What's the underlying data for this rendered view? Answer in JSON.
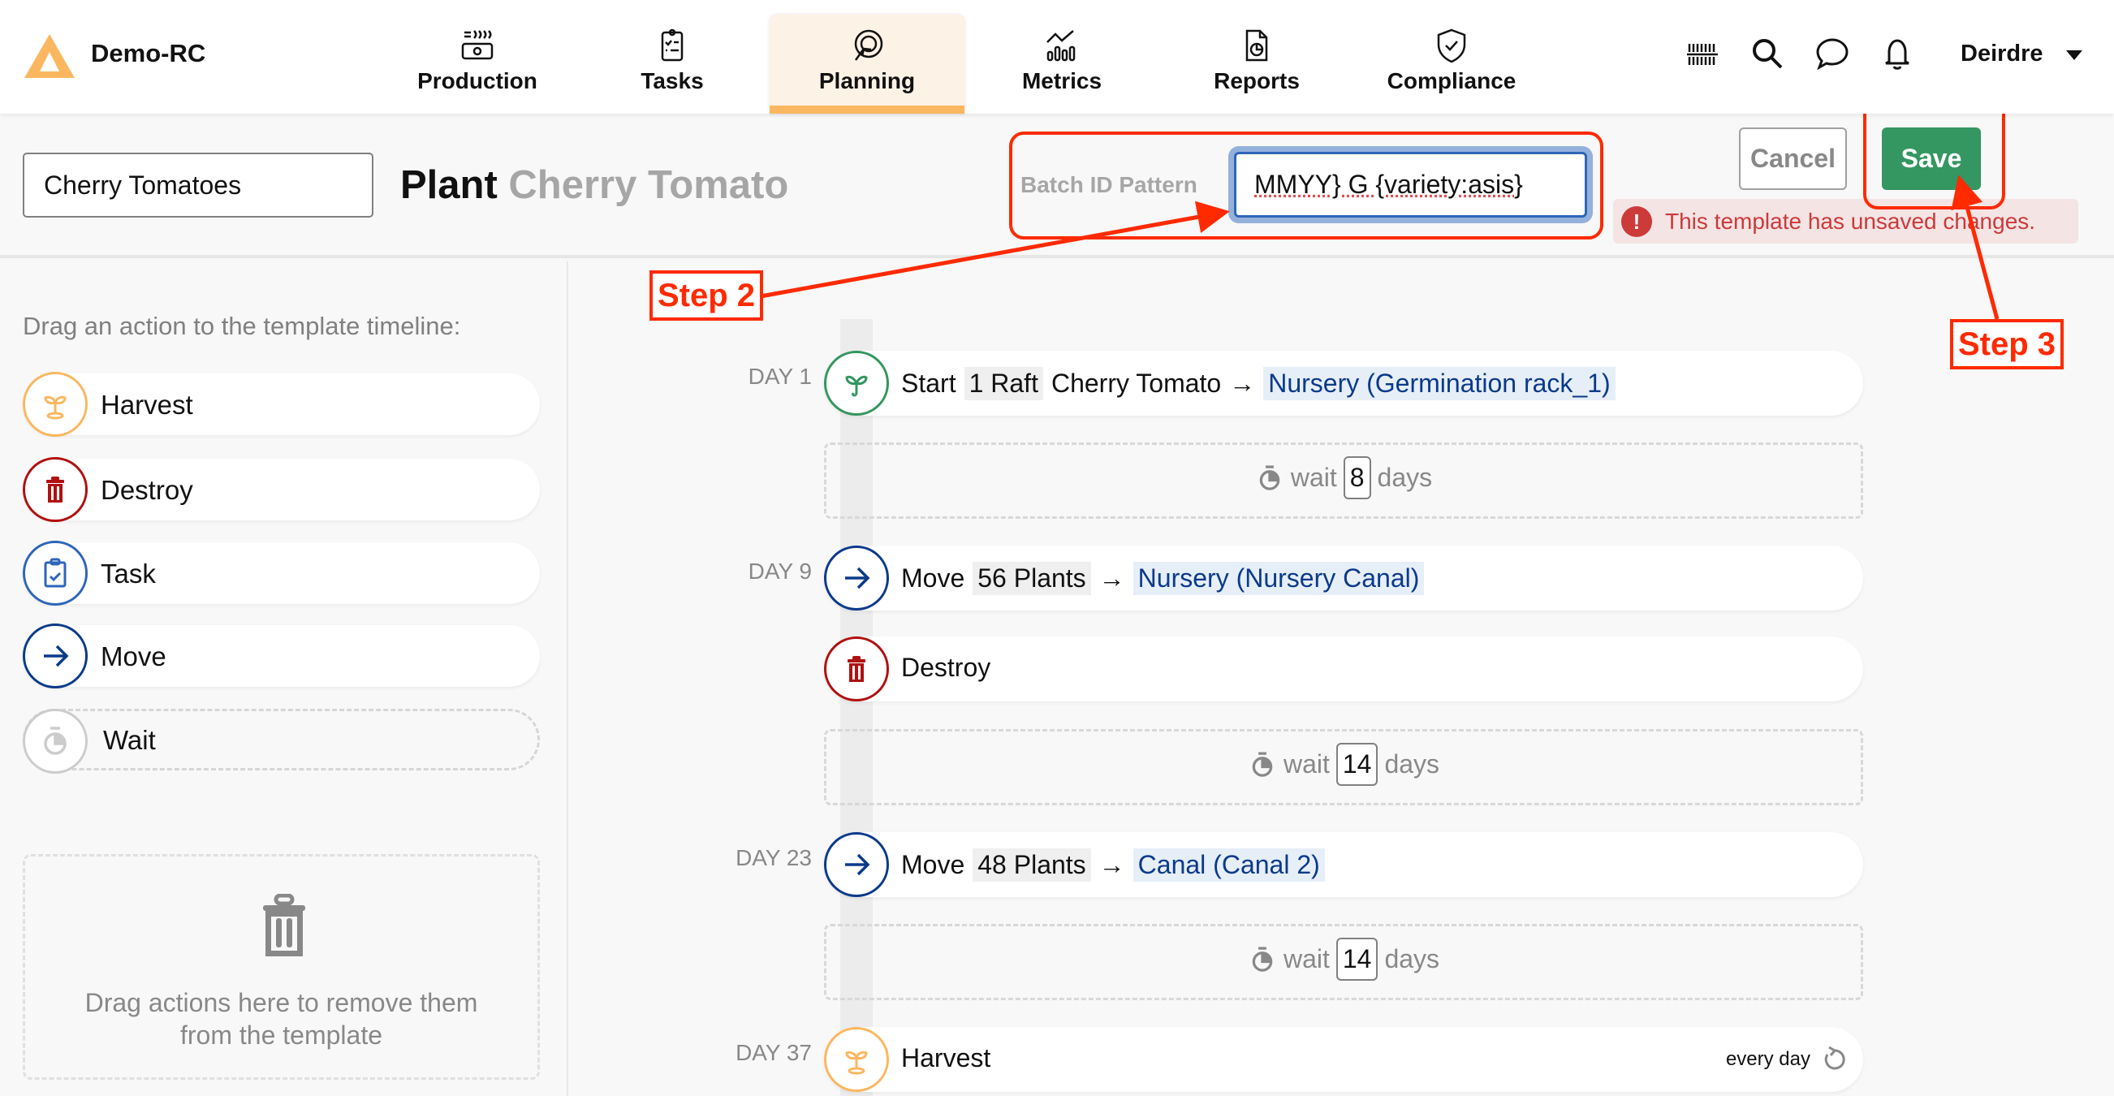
{
  "app": {
    "brand": "Demo-RC",
    "accent": "#fbb760"
  },
  "nav": [
    {
      "label": "Production",
      "icon": "production-icon"
    },
    {
      "label": "Tasks",
      "icon": "tasks-icon"
    },
    {
      "label": "Planning",
      "icon": "planning-icon",
      "active": true
    },
    {
      "label": "Metrics",
      "icon": "metrics-icon"
    },
    {
      "label": "Reports",
      "icon": "reports-icon"
    },
    {
      "label": "Compliance",
      "icon": "compliance-icon"
    }
  ],
  "header_right": {
    "user": "Deirdre",
    "icons": [
      "barcode-icon",
      "search-icon",
      "chat-icon",
      "bell-icon"
    ]
  },
  "template": {
    "name_value": "Cherry Tomatoes",
    "title_action": "Plant",
    "title_variety": "Cherry Tomato",
    "batch_label": "Batch ID Pattern",
    "batch_value": "MMYY} G {variety:asis}",
    "cancel_label": "Cancel",
    "save_label": "Save",
    "warning": "This template has unsaved changes.",
    "save_color": "#349660",
    "warning_color": "#cc3a3a"
  },
  "sidebar": {
    "hint": "Drag an action to the template timeline:",
    "actions": [
      {
        "label": "Harvest",
        "icon": "sprout-icon",
        "color": "#fbb760"
      },
      {
        "label": "Destroy",
        "icon": "trash-icon",
        "color": "#b01010"
      },
      {
        "label": "Task",
        "icon": "clipboard-check-icon",
        "color": "#2e66b7"
      },
      {
        "label": "Move",
        "icon": "arrow-right-icon",
        "color": "#0b3a8a"
      },
      {
        "label": "Wait",
        "icon": "stopwatch-icon",
        "color": "#cccccc"
      }
    ],
    "dropzone_text": "Drag actions here to remove them from the template"
  },
  "timeline": {
    "start": {
      "day": "DAY 1",
      "verb": "Start",
      "qty": "1 Raft",
      "crop": "Cherry Tomato",
      "arrow": "→",
      "location": "Nursery (Germination rack_1)"
    },
    "wait1": {
      "label": "wait",
      "value": "8",
      "unit": "days"
    },
    "move1": {
      "day": "DAY 9",
      "verb": "Move",
      "qty": "56 Plants",
      "arrow": "→",
      "location": "Nursery (Nursery Canal)"
    },
    "destroy": {
      "verb": "Destroy"
    },
    "wait2": {
      "label": "wait",
      "value": "14",
      "unit": "days"
    },
    "move2": {
      "day": "DAY 23",
      "verb": "Move",
      "qty": "48 Plants",
      "arrow": "→",
      "location": "Canal (Canal 2)"
    },
    "wait3": {
      "label": "wait",
      "value": "14",
      "unit": "days"
    },
    "harvest": {
      "day": "DAY 37",
      "verb": "Harvest",
      "repeat": "every day"
    }
  },
  "annotations": {
    "step2": "Step 2",
    "step3": "Step 3",
    "color": "#ff2a00"
  }
}
